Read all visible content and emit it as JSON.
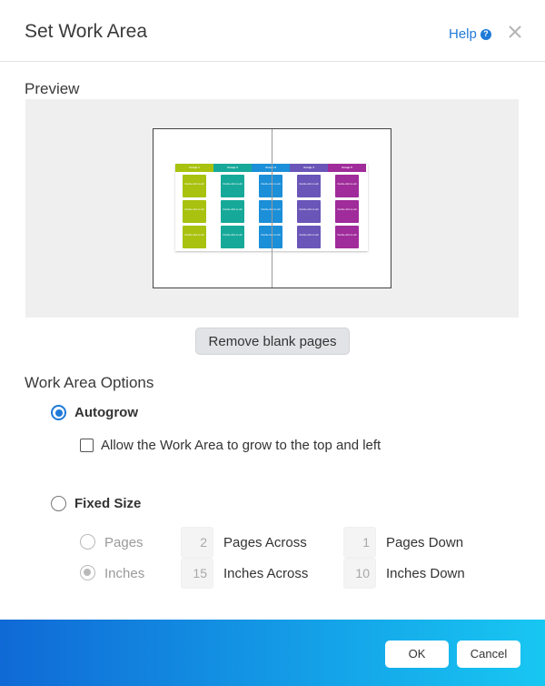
{
  "dialog": {
    "title": "Set Work Area",
    "help_label": "Help",
    "help_icon": "?"
  },
  "preview": {
    "label": "Preview",
    "columns": [
      {
        "header": "Group 1",
        "color": "#a8c20f"
      },
      {
        "header": "Group 2",
        "color": "#16a99a"
      },
      {
        "header": "Group 3",
        "color": "#1b8fd8"
      },
      {
        "header": "Group 4",
        "color": "#6a55b8"
      },
      {
        "header": "Group 5",
        "color": "#a02b9a"
      }
    ],
    "card_text": "Double-click to edit"
  },
  "remove_blank_label": "Remove blank pages",
  "options": {
    "label": "Work Area Options",
    "autogrow_label": "Autogrow",
    "allow_grow_label": "Allow the Work Area to grow to the top and left",
    "fixed_size_label": "Fixed Size",
    "pages_label": "Pages",
    "inches_label": "Inches",
    "pages_across_value": "2",
    "pages_across_label": "Pages Across",
    "pages_down_value": "1",
    "pages_down_label": "Pages Down",
    "inches_across_value": "15",
    "inches_across_label": "Inches Across",
    "inches_down_value": "10",
    "inches_down_label": "Inches Down"
  },
  "footer": {
    "ok_label": "OK",
    "cancel_label": "Cancel"
  },
  "colors": {
    "accent": "#1f7ad8",
    "footer_start": "#1069d6",
    "footer_end": "#18c7f2"
  }
}
